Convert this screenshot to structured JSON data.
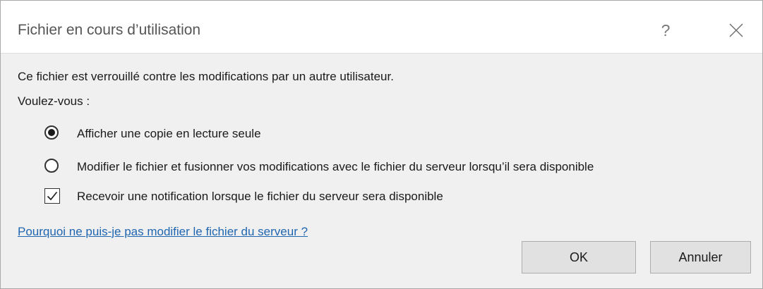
{
  "dialog": {
    "title": "Fichier en cours d’utilisation",
    "help_symbol": "?",
    "message": "Ce fichier est verrouillé contre les modifications par un autre utilisateur.",
    "question": "Voulez-vous :",
    "options": [
      {
        "label": "Afficher une copie en lecture seule",
        "selected": true,
        "type": "radio"
      },
      {
        "label": "Modifier le fichier et fusionner vos modifications avec le fichier du serveur lorsqu’il sera disponible",
        "selected": false,
        "type": "radio"
      },
      {
        "label": "Recevoir une notification lorsque le fichier du serveur sera disponible",
        "checked": true,
        "type": "checkbox"
      }
    ],
    "link": "Pourquoi ne puis-je pas modifier le fichier du serveur ?",
    "buttons": {
      "ok": "OK",
      "cancel": "Annuler"
    }
  },
  "colors": {
    "link": "#1f66b1",
    "background": "#f0f0f0",
    "button": "#e1e1e1"
  }
}
